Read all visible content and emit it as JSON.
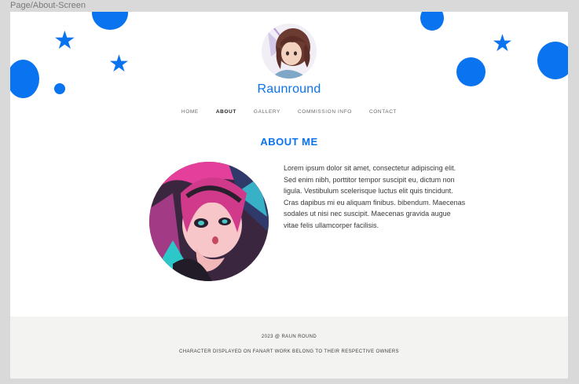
{
  "frame": {
    "label": "Page/About-Screen"
  },
  "header": {
    "site_title": "Raunround"
  },
  "nav": {
    "items": [
      {
        "label": "HOME"
      },
      {
        "label": "ABOUT"
      },
      {
        "label": "GALLERY"
      },
      {
        "label": "COMMISSION INFO"
      },
      {
        "label": "CONTACT"
      }
    ],
    "active": "ABOUT"
  },
  "main": {
    "heading": "ABOUT ME",
    "body_text": "Lorem ipsum dolor sit amet, consectetur adipiscing elit. Sed enim nibh, porttitor tempor suscipit eu, dictum non ligula. Vestibulum scelerisque luctus elit quis tincidunt. Cras dapibus mi eu aliquam finibus. bibendum. Maecenas sodales ut nisi nec suscipit. Maecenas gravida augue vitae felis ullamcorper facilisis."
  },
  "footer": {
    "copyright": "2023 @ RAUN ROUND",
    "disclaimer": "CHARACTER DISPLAYED ON FANART WORK BELONG TO THEIR RESPECTIVE OWNERS"
  },
  "colors": {
    "accent": "#0a73ef",
    "canvas": "#d9d9d9",
    "footer_bg": "#f3f3f2"
  },
  "icons": [
    "star-icon",
    "circle-decoration"
  ]
}
